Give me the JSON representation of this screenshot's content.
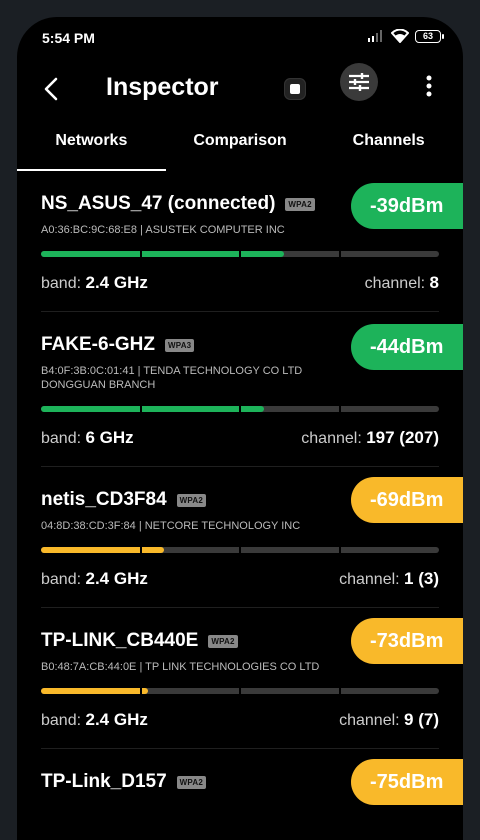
{
  "status": {
    "time": "5:54 PM",
    "battery": "63"
  },
  "app": {
    "title": "Inspector"
  },
  "tabs": [
    {
      "label": "Networks",
      "active": true
    },
    {
      "label": "Comparison",
      "active": false
    },
    {
      "label": "Channels",
      "active": false
    }
  ],
  "labels": {
    "band": "band: ",
    "channel": "channel: "
  },
  "colors": {
    "strong": "#1db35a",
    "weak": "#f9b92a",
    "track": "#3a3a3a"
  },
  "networks": [
    {
      "ssid": "NS_ASUS_47 (connected)",
      "security": "WPA2",
      "meta": "A0:36:BC:9C:68:E8  | ASUSTEK COMPUTER INC",
      "signal": "-39dBm",
      "level": 0.61,
      "color": "#1db35a",
      "band": "2.4 GHz",
      "channel": "8"
    },
    {
      "ssid": "FAKE-6-GHZ",
      "security": "WPA3",
      "meta": "B4:0F:3B:0C:01:41  | TENDA TECHNOLOGY CO LTD DONGGUAN BRANCH",
      "signal": "-44dBm",
      "level": 0.56,
      "color": "#1db35a",
      "band": "6 GHz",
      "channel": "197 (207)"
    },
    {
      "ssid": "netis_CD3F84",
      "security": "WPA2",
      "meta": "04:8D:38:CD:3F:84  | NETCORE TECHNOLOGY INC",
      "signal": "-69dBm",
      "level": 0.31,
      "color": "#f9b92a",
      "band": "2.4 GHz",
      "channel": "1 (3)"
    },
    {
      "ssid": "TP-LINK_CB440E",
      "security": "WPA2",
      "meta": "B0:48:7A:CB:44:0E  | TP LINK TECHNOLOGIES CO LTD",
      "signal": "-73dBm",
      "level": 0.27,
      "color": "#f9b92a",
      "band": "2.4 GHz",
      "channel": "9 (7)"
    },
    {
      "ssid": "TP-Link_D157",
      "security": "WPA2",
      "meta": "",
      "signal": "-75dBm",
      "level": 0.25,
      "color": "#f9b92a",
      "band": "",
      "channel": ""
    }
  ]
}
